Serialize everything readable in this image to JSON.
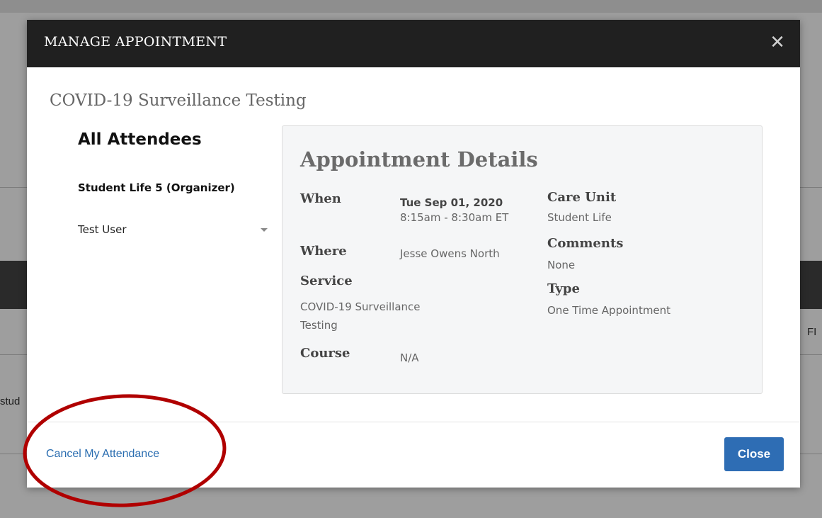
{
  "background": {
    "left_fragment": "stud",
    "right_fragment": "FI"
  },
  "modal": {
    "title": "MANAGE APPOINTMENT",
    "service_heading": "COVID-19 Surveillance Testing",
    "attendees": {
      "title": "All Attendees",
      "organizer": "Student Life 5 (Organizer)",
      "user": "Test User"
    },
    "details": {
      "title": "Appointment Details",
      "when_label": "When",
      "when_date": "Tue Sep 01, 2020",
      "when_time": "8:15am - 8:30am ET",
      "where_label": "Where",
      "where_value": "Jesse Owens North",
      "service_label": "Service",
      "service_value_line1": "COVID-19 Surveillance",
      "service_value_line2": "Testing",
      "course_label": "Course",
      "course_value": "N/A",
      "care_unit_label": "Care Unit",
      "care_unit_value": "Student Life",
      "comments_label": "Comments",
      "comments_value": "None",
      "type_label": "Type",
      "type_value": "One Time Appointment"
    },
    "footer": {
      "cancel_label": "Cancel My Attendance",
      "close_label": "Close"
    }
  },
  "icons": {
    "close": "close-icon",
    "dropdown": "chevron-down-icon"
  },
  "colors": {
    "header_bg": "#202020",
    "primary_button": "#2e6db4",
    "link": "#2a6db0",
    "annotation": "#b00000"
  }
}
